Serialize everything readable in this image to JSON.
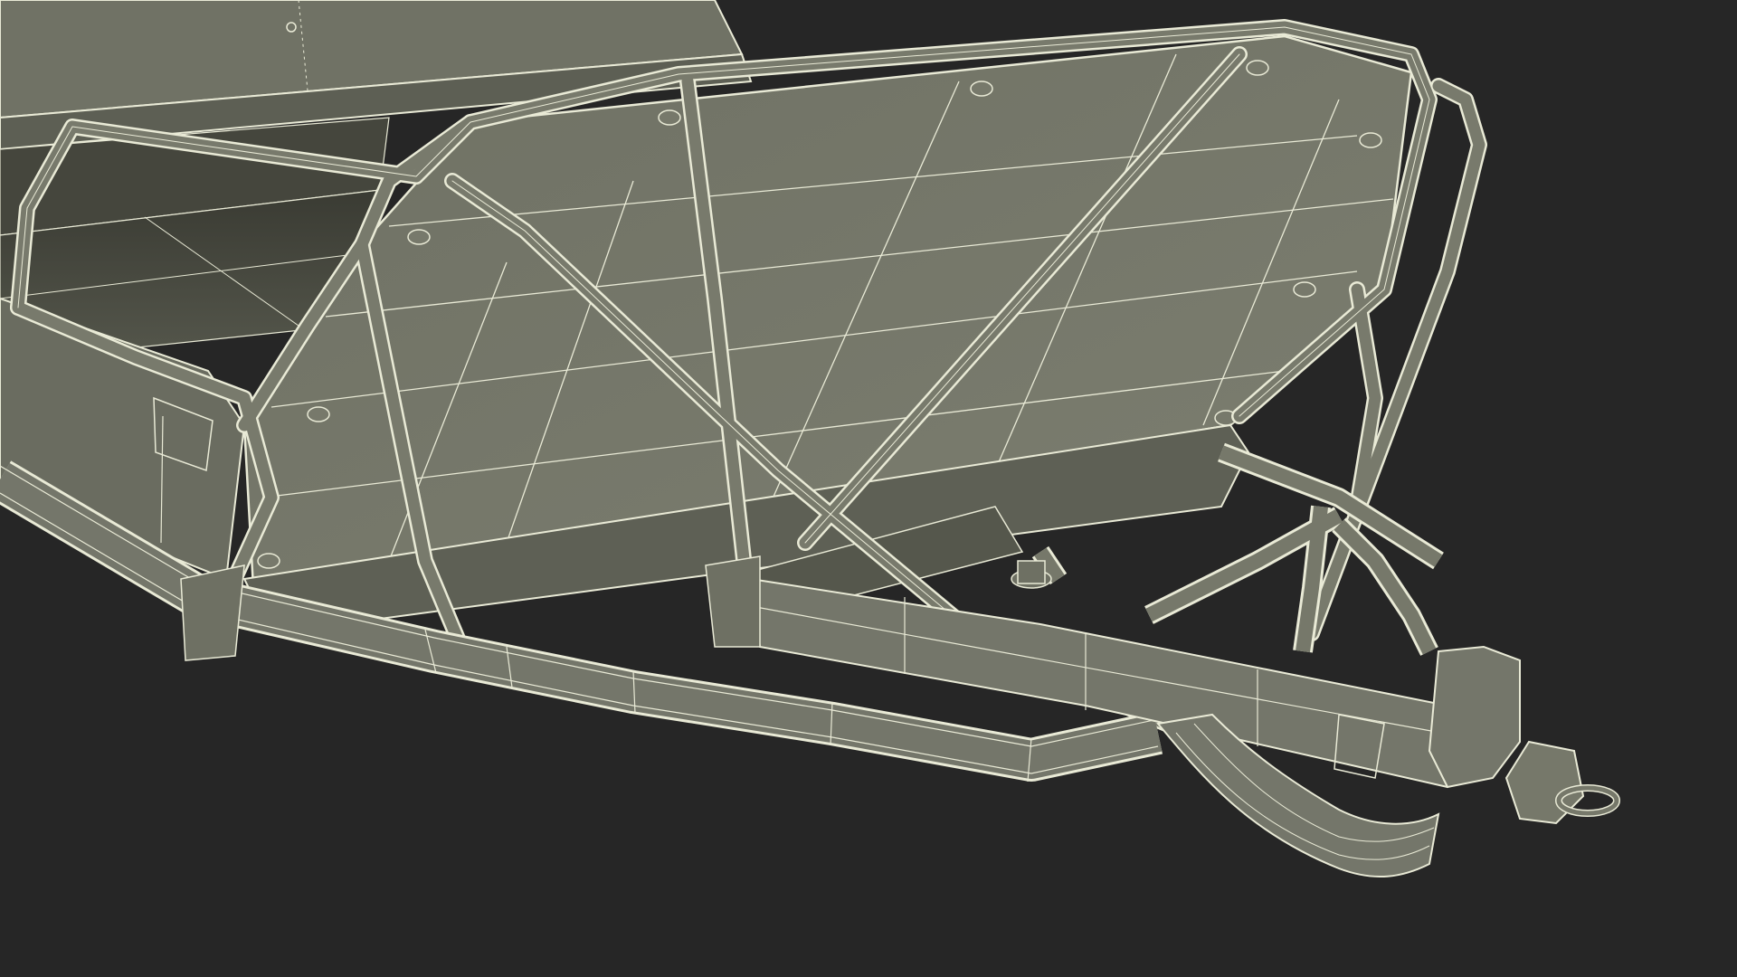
{
  "scene": {
    "subject": "wireframe-render",
    "background_color": "#262626",
    "surface_color": "#76786a",
    "surface_dark_color": "#5e6055",
    "wire_color": "#e9ead6"
  }
}
